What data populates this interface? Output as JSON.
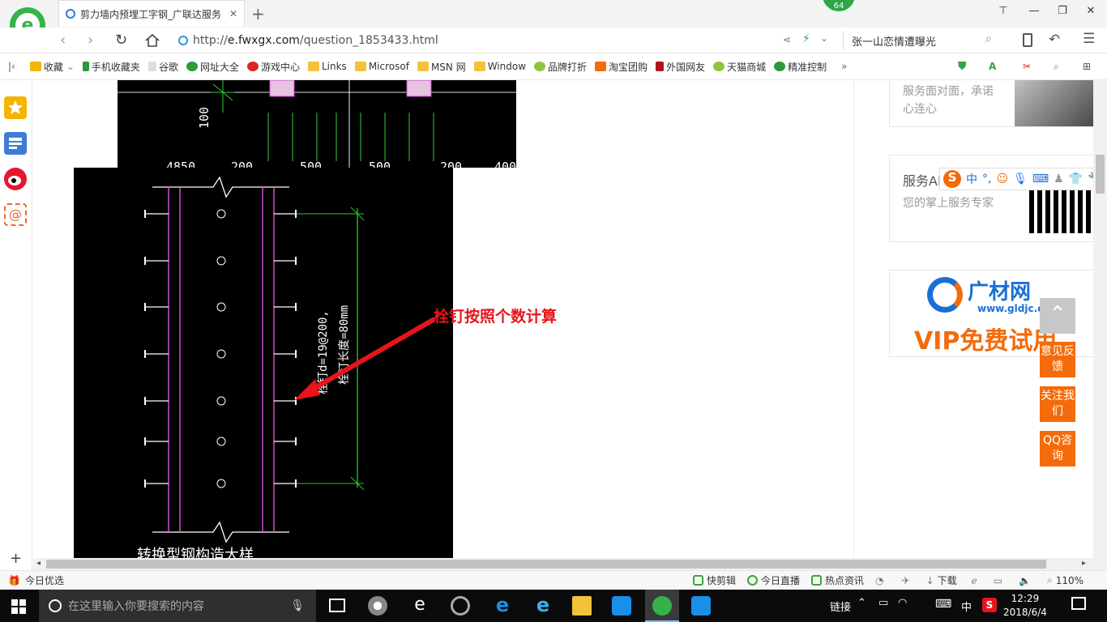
{
  "browser": {
    "tab_title": "剪力墙内预埋工字钢_广联达服务",
    "new_tab": "+",
    "speed_badge": "64",
    "url_scheme": "http://",
    "url_host": "e.fwxgx.com",
    "url_path": "/question_1853433.html",
    "search_text": "张一山恋情遭曝光",
    "win_controls": [
      "⊤",
      "—",
      "❐",
      "✕"
    ]
  },
  "bookmarks": [
    {
      "label": "收藏",
      "color": "#f5b400"
    },
    {
      "label": "手机收藏夹",
      "color": "#2a9a3a"
    },
    {
      "label": "谷歌",
      "color": "#cccccc"
    },
    {
      "label": "网址大全",
      "color": "#2a9a3a"
    },
    {
      "label": "游戏中心",
      "color": "#d8282a"
    },
    {
      "label": "Links",
      "color": "#f2c23a"
    },
    {
      "label": "Microsof",
      "color": "#f2c23a"
    },
    {
      "label": "MSN 网",
      "color": "#f2c23a"
    },
    {
      "label": "Window",
      "color": "#f2c23a"
    },
    {
      "label": "品牌打折",
      "color": "#8cc63f"
    },
    {
      "label": "淘宝团购",
      "color": "#f46b0b"
    },
    {
      "label": "外国网友",
      "color": "#b3121f"
    },
    {
      "label": "天猫商城",
      "color": "#8cc63f"
    },
    {
      "label": "精准控制",
      "color": "#2a9a3a"
    }
  ],
  "bookmarks_more": "»",
  "cad": {
    "dim_top": [
      "4850",
      "200",
      "500",
      "500",
      "200",
      "400"
    ],
    "dim_side": "100",
    "label_spacing": "栓钉d=19@200,",
    "label_length": "栓钉长度=80mm",
    "caption": "转换型钢构造大样",
    "annotation": "栓钉按照个数计算"
  },
  "sidebar_cards": [
    {
      "title": "",
      "desc": "服务面对面，承诺心连心"
    },
    {
      "title": "服务APP",
      "desc": "您的掌上服务专家"
    },
    {
      "title": "广材网",
      "desc": "www.gldjc.com",
      "banner": "VIP免费试用"
    }
  ],
  "side_buttons": [
    "意见反馈",
    "关注我们",
    "QQ咨询"
  ],
  "ime_label": "中",
  "status_bar": {
    "left": "今日优选",
    "items": [
      "快剪辑",
      "今日直播",
      "热点资讯"
    ],
    "download": "下载",
    "zoom": "110%"
  },
  "taskbar": {
    "search_placeholder": "在这里输入你要搜索的内容",
    "tray_links": "链接",
    "ime": "中",
    "time": "12:29",
    "date": "2018/6/4"
  }
}
